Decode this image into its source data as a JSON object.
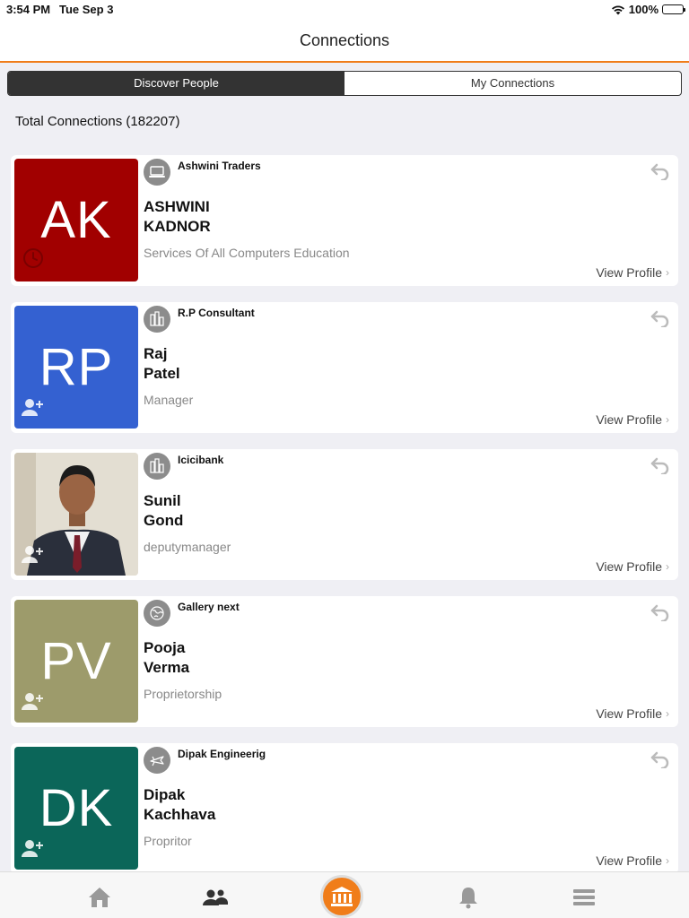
{
  "status_bar": {
    "time": "3:54 PM",
    "date": "Tue Sep 3",
    "battery": "100%"
  },
  "header": {
    "title": "Connections"
  },
  "segments": {
    "discover": "Discover People",
    "my_connections": "My Connections",
    "active": "Discover People"
  },
  "total_connections": "Total Connections (182207)",
  "colors": {
    "accent": "#f07d1a",
    "ak": "#a10000",
    "rp": "#3461d1",
    "pv": "#9d9b6b",
    "dk": "#0b6659"
  },
  "cards": [
    {
      "initials": "AK",
      "company": "Ashwini Traders",
      "first": "ASHWINI",
      "last": "KADNOR",
      "role": "Services Of All Computers Education",
      "link": "View Profile",
      "category_icon": "computer-icon",
      "corner_icon": "clock-icon"
    },
    {
      "initials": "RP",
      "company": "R.P Consultant",
      "first": "Raj",
      "last": "Patel",
      "role": "Manager",
      "link": "View Profile",
      "category_icon": "building-icon",
      "corner_icon": "add-person-icon"
    },
    {
      "initials": "",
      "company": "Icicibank",
      "first": "Sunil",
      "last": "Gond",
      "role": "deputymanager",
      "link": "View Profile",
      "category_icon": "building-icon",
      "corner_icon": "add-person-icon"
    },
    {
      "initials": "PV",
      "company": "Gallery next",
      "first": "Pooja",
      "last": "Verma",
      "role": "Proprietorship",
      "link": "View Profile",
      "category_icon": "globe-icon",
      "corner_icon": "add-person-icon"
    },
    {
      "initials": "DK",
      "company": "Dipak Engineerig",
      "first": "Dipak",
      "last": "Kachhava",
      "role": "Propritor",
      "link": "View Profile",
      "category_icon": "airplane-icon",
      "corner_icon": "add-person-icon"
    }
  ],
  "tab_bar": {
    "items": [
      "home-icon",
      "people-icon",
      "bank-icon",
      "bell-icon",
      "menu-icon"
    ],
    "active": "people-icon"
  }
}
